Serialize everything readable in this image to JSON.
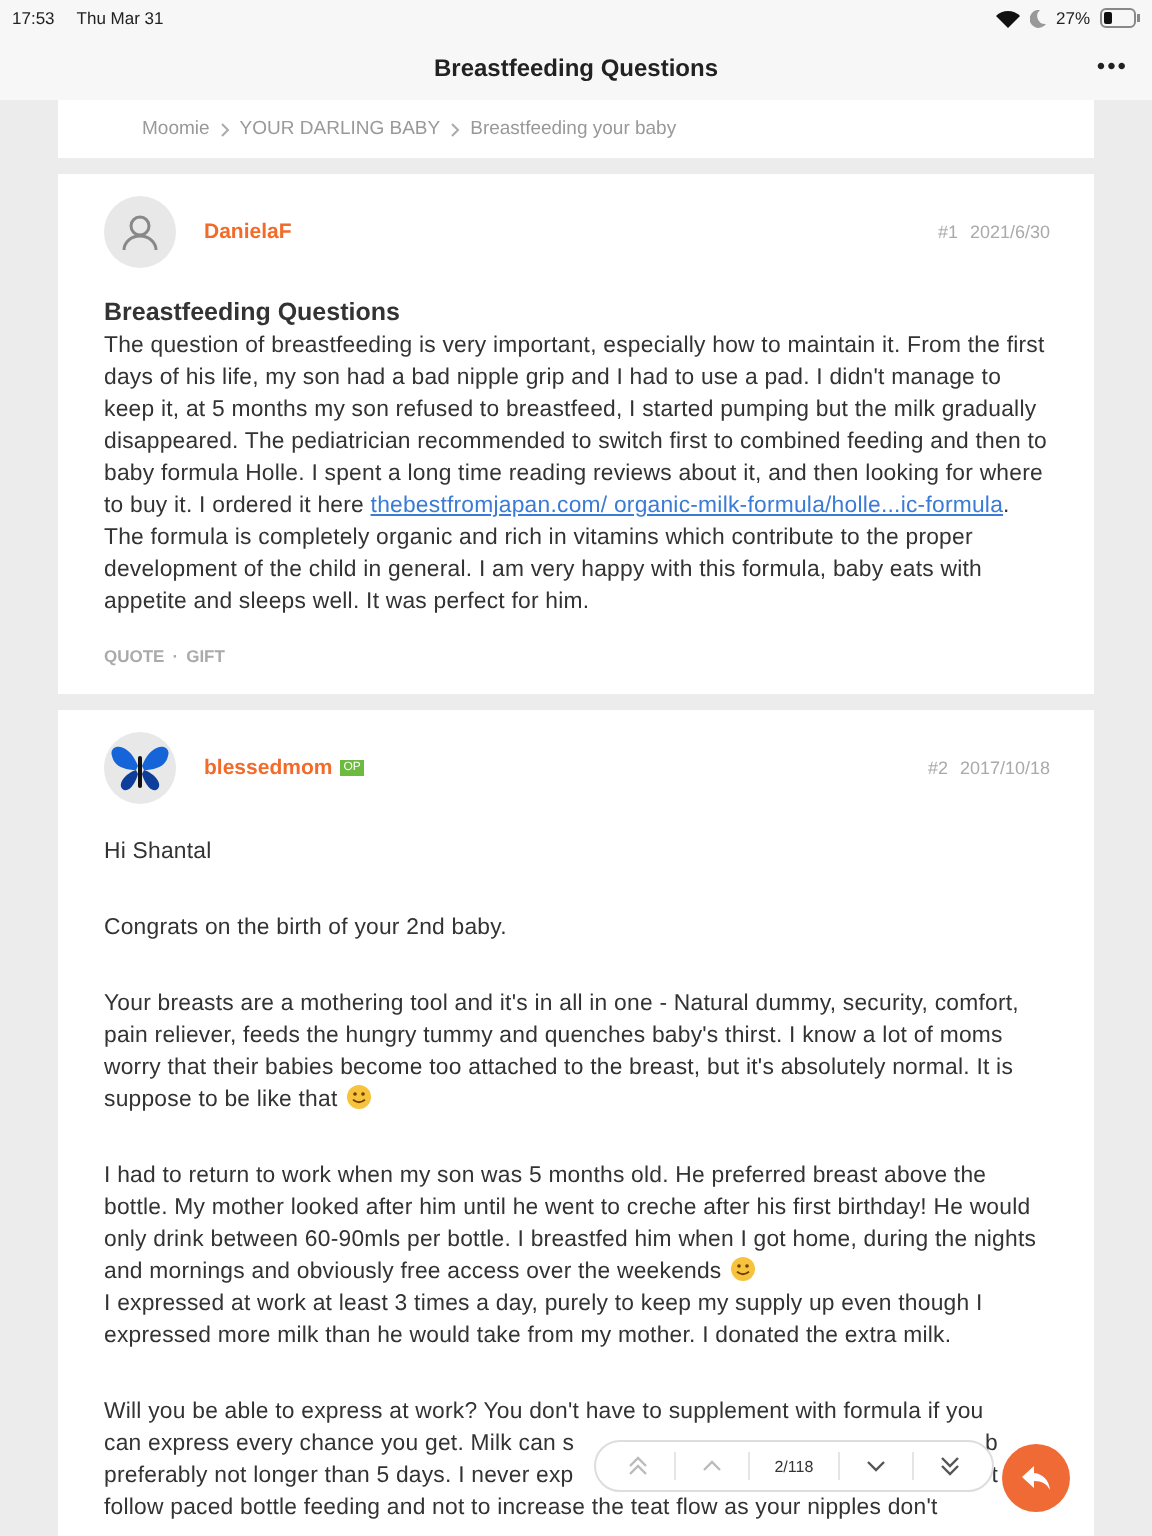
{
  "status_bar": {
    "time": "17:53",
    "date": "Thu Mar 31",
    "battery": "27%"
  },
  "nav": {
    "title": "Breastfeeding Questions",
    "more": "•••"
  },
  "breadcrumb": [
    "Moomie",
    "YOUR DARLING BABY",
    "Breastfeeding your baby"
  ],
  "posts": [
    {
      "author": "DanielaF",
      "avatar": {
        "kind": "person"
      },
      "op": false,
      "number": "#1",
      "date": "2021/6/30",
      "title": "Breastfeeding Questions",
      "blocks": [
        [
          {
            "text": "The question of breastfeeding is very important, especially how to maintain it. From the first days of his life, my son had a bad nipple grip and I had to use a pad. I didn't manage to keep it, at 5 months my son refused to breastfeed, I started pumping but the milk gradually disappeared. The pediatrician recommended to switch first to combined feeding and then to baby formula Holle. I spent a long time reading reviews about it, and then looking for where to buy it. I ordered it here ",
            "link": "thebestfromjapan.com/ organic-milk-formula/holle...ic-formula",
            "after": ". The formula is completely organic and rich in vitamins which contribute to the proper development of the child in general. I am very happy with this formula, baby eats with appetite and sleeps well. It was perfect for him.",
            "smiley": false
          }
        ]
      ],
      "actions": [
        "QUOTE",
        "GIFT"
      ],
      "action_separator": "·"
    },
    {
      "author": "blessedmom",
      "avatar": {
        "kind": "picture"
      },
      "op": true,
      "op_label": "OP",
      "number": "#2",
      "date": "2017/10/18",
      "blocks": [
        [
          {
            "text": "Hi Shantal",
            "smiley": false
          }
        ],
        [
          {
            "text": "Congrats on the birth of your 2nd baby.",
            "smiley": false
          }
        ],
        [
          {
            "text": "Your breasts are a mothering tool and it's in all in one - Natural dummy, security, comfort, pain reliever, feeds the hungry tummy and quenches baby's thirst. I know a lot of moms worry that their babies become too attached to the breast, but it's absolutely normal. It is suppose to be like that",
            "smiley": true
          }
        ],
        [
          {
            "text": "I had to return to work when my son was 5 months old. He preferred breast above the bottle. My mother looked after him until he went to creche after his first birthday! He would only drink between 60-90mls per bottle. I breastfed him when I got home, during the nights and mornings and obviously free access over the weekends",
            "smiley": true
          },
          {
            "text": "I expressed at work at least 3 times a day, purely to keep my supply up even though I expressed more milk than he would take from my mother. I donated the extra milk.",
            "smiley": false
          }
        ]
      ],
      "covered_lines": [
        {
          "left": "Will you be able to express at work? You don't have to supplement with formula if you"
        },
        {
          "left": "can express every chance you get. Milk can s",
          "right": "b"
        },
        {
          "left": "preferably not longer than 5 days. I never exp",
          "right": "t"
        },
        {
          "left": "follow paced bottle feeding and not to increase the teat flow as your nipples don't"
        }
      ]
    }
  ],
  "pager": {
    "page": "2/118"
  }
}
